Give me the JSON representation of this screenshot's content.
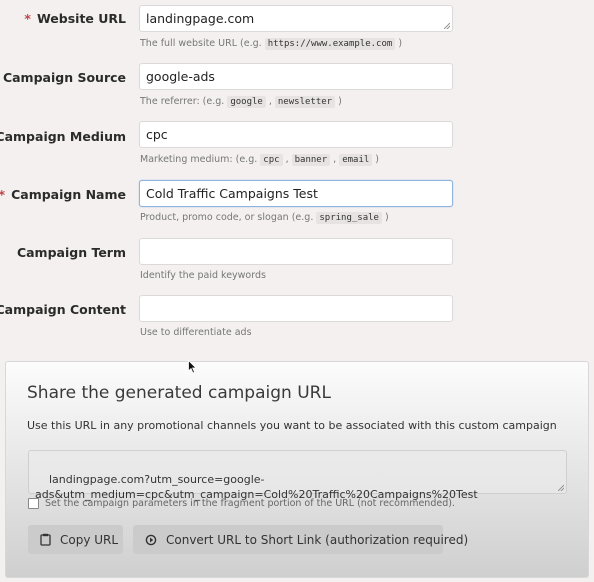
{
  "form": {
    "fields": [
      {
        "label": "Website URL",
        "required": true,
        "value": "landingpage.com",
        "help_prefix": "The full website URL (e.g. ",
        "help_codes": [
          "https://www.example.com"
        ],
        "help_suffix": " )"
      },
      {
        "label": "Campaign Source",
        "required": true,
        "value": "google-ads",
        "help_prefix": "The referrer: (e.g. ",
        "help_codes": [
          "google",
          "newsletter"
        ],
        "help_suffix": " )"
      },
      {
        "label": "Campaign Medium",
        "required": true,
        "value": "cpc",
        "help_prefix": "Marketing medium: (e.g. ",
        "help_codes": [
          "cpc",
          "banner",
          "email"
        ],
        "help_suffix": " )"
      },
      {
        "label": "Campaign Name",
        "required": true,
        "value": "Cold Traffic Campaigns Test",
        "help_prefix": "Product, promo code, or slogan (e.g. ",
        "help_codes": [
          "spring_sale"
        ],
        "help_suffix": " )"
      },
      {
        "label": "Campaign Term",
        "required": false,
        "value": "",
        "help_prefix": "Identify the paid keywords"
      },
      {
        "label": "Campaign Content",
        "required": false,
        "value": "",
        "help_prefix": "Use to differentiate ads"
      }
    ],
    "required_marker": "*"
  },
  "output": {
    "title": "Share the generated campaign URL",
    "description": "Use this URL in any promotional channels you want to be associated with this custom campaign",
    "generated_url": "landingpage.com?utm_source=google-ads&utm_medium=cpc&utm_campaign=Cold%20Traffic%20Campaigns%20Test",
    "generated_url_display": "landingpage.com?utm_source=google-\nads&utm_medium=cpc&utm_campaign=Cold%20Traffic%20Campaigns%20Test",
    "fragment_checkbox_label": "Set the campaign parameters in the fragment portion of the URL (not recommended).",
    "fragment_checked": false,
    "copy_button": "Copy URL",
    "shorten_button": "Convert URL to Short Link (authorization required)"
  },
  "colors": {
    "required": "#c0444a",
    "focus_border": "#8eb4e0"
  }
}
